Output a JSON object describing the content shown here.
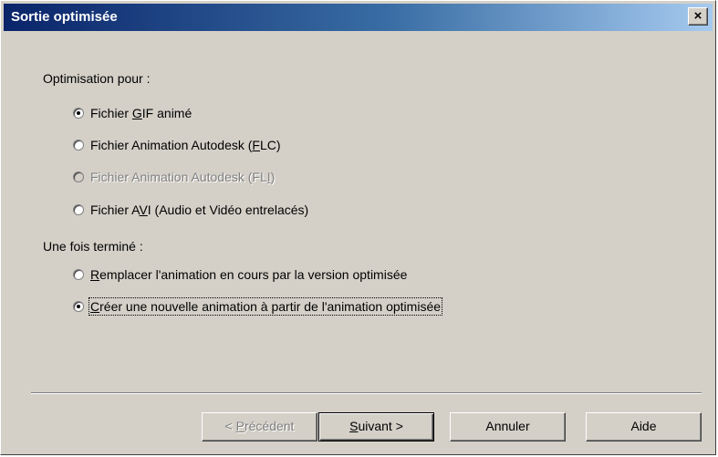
{
  "window": {
    "title": "Sortie optimisée",
    "close_label": "×"
  },
  "optimization": {
    "label": "Optimisation pour :",
    "options": [
      {
        "label": "Fichier GIF animé",
        "mnemonic": "G",
        "checked": true,
        "disabled": false
      },
      {
        "label": "Fichier Animation Autodesk (FLC)",
        "mnemonic": "F",
        "checked": false,
        "disabled": false
      },
      {
        "label": "Fichier Animation Autodesk (FLI)",
        "mnemonic": "I",
        "checked": false,
        "disabled": true
      },
      {
        "label": "Fichier AVI (Audio et Vidéo entrelacés)",
        "mnemonic": "V",
        "checked": false,
        "disabled": false
      }
    ]
  },
  "when_done": {
    "label": "Une fois terminé :",
    "options": [
      {
        "label": "Remplacer l'animation en cours par la version optimisée",
        "mnemonic": "R",
        "checked": false
      },
      {
        "label": "Créer une nouvelle animation à partir de l'animation optimisée",
        "mnemonic": "C",
        "checked": true
      }
    ]
  },
  "buttons": {
    "previous": "< Précédent",
    "next": "Suivant >",
    "cancel": "Annuler",
    "help": "Aide"
  },
  "icons": {
    "close": "close-icon",
    "radio": "radio-button"
  }
}
